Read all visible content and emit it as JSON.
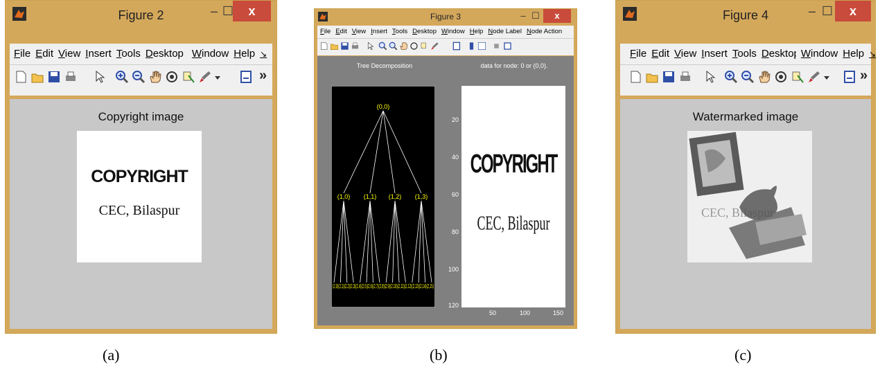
{
  "panels": [
    {
      "window_title": "Figure 2",
      "menu": [
        "File",
        "Edit",
        "View",
        "Insert",
        "Tools",
        "Desktop",
        "Window",
        "Help"
      ],
      "menu_overflow": "»",
      "plot_title": "Copyright image",
      "image_text_top": "COPYRIGHT",
      "image_text_bottom": "CEC, Bilaspur",
      "caption": "(a)"
    },
    {
      "window_title": "Figure 3",
      "menu": [
        "File",
        "Edit",
        "View",
        "Insert",
        "Tools",
        "Desktop",
        "Window",
        "Help",
        "Node Label",
        "Node Action"
      ],
      "menu_overflow": "»",
      "tree_title": "Tree Decomposition",
      "data_title": "data for node: 0 or (0,0).",
      "tree_root": "(0,0)",
      "tree_level1": [
        "(1,0)",
        "(1,1)",
        "(1,2)",
        "(1,3)"
      ],
      "tree_leaves": "(2,0)(2,1)(2,2)(2,3)(2,4)(2,5)(2,6)(2,7)(2,8)(2,9)(2,10)(2,11)(2,12)(2,13)(2,14)(2,15)",
      "y_ticks": [
        "20",
        "40",
        "60",
        "80",
        "100",
        "120"
      ],
      "x_ticks": [
        "50",
        "100",
        "150"
      ],
      "image_text_top": "COPYRIGHT",
      "image_text_bottom": "CEC, Bilaspur",
      "caption": "(b)"
    },
    {
      "window_title": "Figure 4",
      "menu": [
        "File",
        "Edit",
        "View",
        "Insert",
        "Tools",
        "Desktop",
        "Window",
        "Help"
      ],
      "menu_overflow": "»",
      "plot_title": "Watermarked image",
      "watermark_text": "CEC, Bilaspur",
      "caption": "(c)"
    }
  ],
  "window_controls": {
    "minimize": "–",
    "maximize": "☐",
    "close": "x"
  },
  "colors": {
    "frame": "#d4a85b",
    "close": "#c94b3b",
    "figure_bg": "#c8c8c8",
    "tree_bg": "#808080",
    "tree_node": "#ffff00"
  }
}
